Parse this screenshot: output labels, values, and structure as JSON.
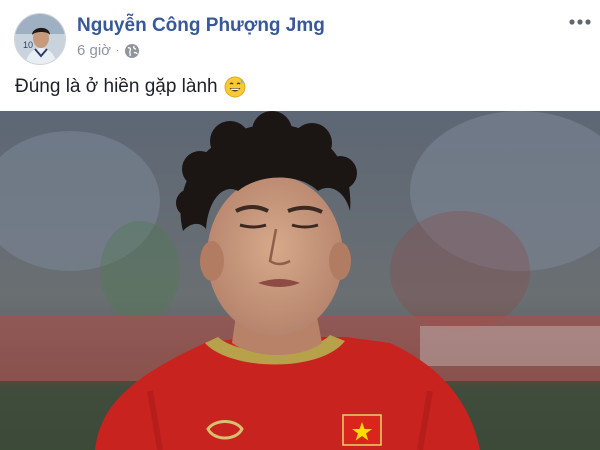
{
  "post": {
    "author_name": "Nguyễn Công Phượng Jmg",
    "timestamp": "6 giờ",
    "separator": "·",
    "privacy_icon": "globe-icon",
    "menu_icon": "more-options-icon",
    "text": "Đúng là ở hiền gặp lành",
    "emoji": "grinning-sweat-emoji"
  },
  "photo": {
    "subject": "football-player-photo",
    "jersey_color": "#c8231f",
    "collar_color": "#b7a14a"
  },
  "colors": {
    "name_link": "#385898",
    "meta_text": "#90949c",
    "body_text": "#1d2129"
  }
}
